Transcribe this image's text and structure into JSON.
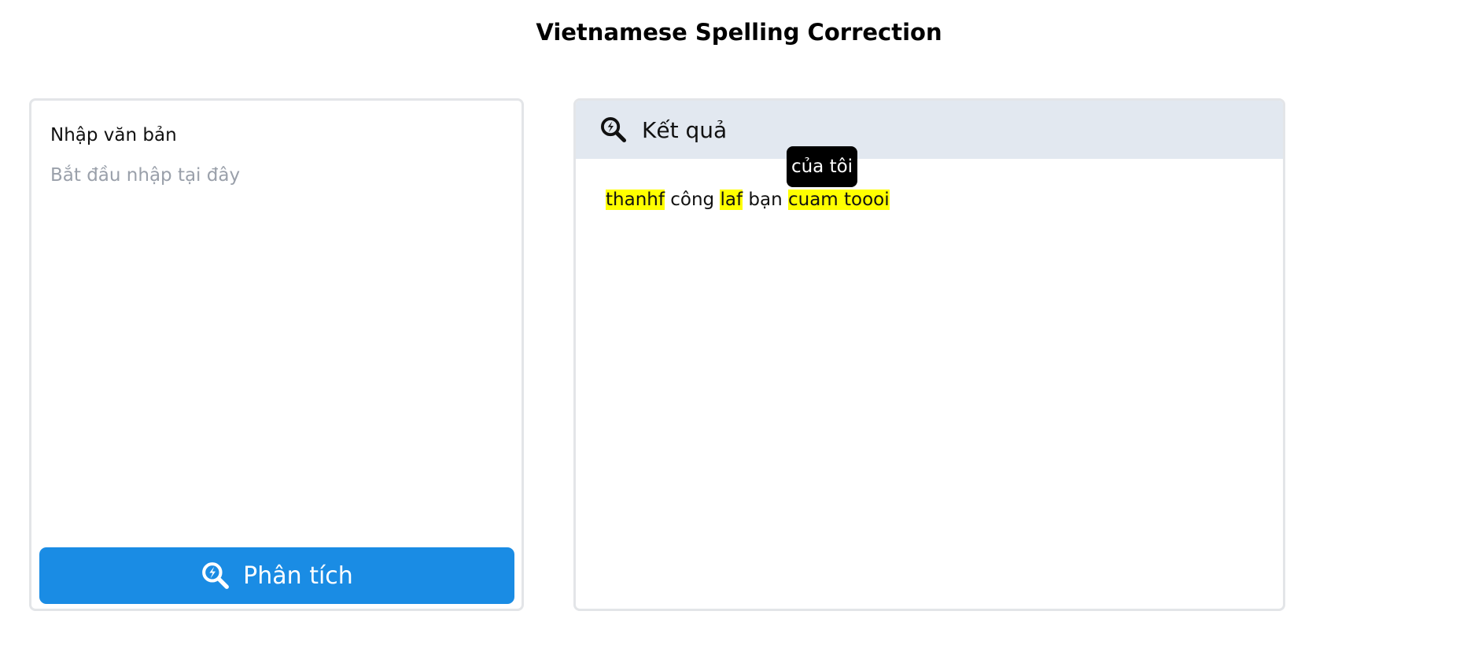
{
  "page": {
    "title": "Vietnamese Spelling Correction"
  },
  "input_panel": {
    "label": "Nhập văn bản",
    "placeholder": "Bắt đầu nhập tại đây",
    "value": "",
    "analyze_button_label": "Phân tích",
    "analyze_button_icon": "search-analyze-icon"
  },
  "result_panel": {
    "title": "Kết quả",
    "icon": "search-analyze-icon",
    "words": [
      {
        "text": "thanhf",
        "error": true
      },
      {
        "text": "công",
        "error": false
      },
      {
        "text": "laf",
        "error": true
      },
      {
        "text": "bạn",
        "error": false
      },
      {
        "text": "cuam toooi",
        "error": true
      }
    ],
    "tooltip": "của tôi"
  },
  "colors": {
    "accent": "#1a8ce4",
    "highlight": "#ffff00",
    "header_bg": "#e2e8f0",
    "border": "#e3e5e8",
    "tooltip_bg": "#000000"
  }
}
